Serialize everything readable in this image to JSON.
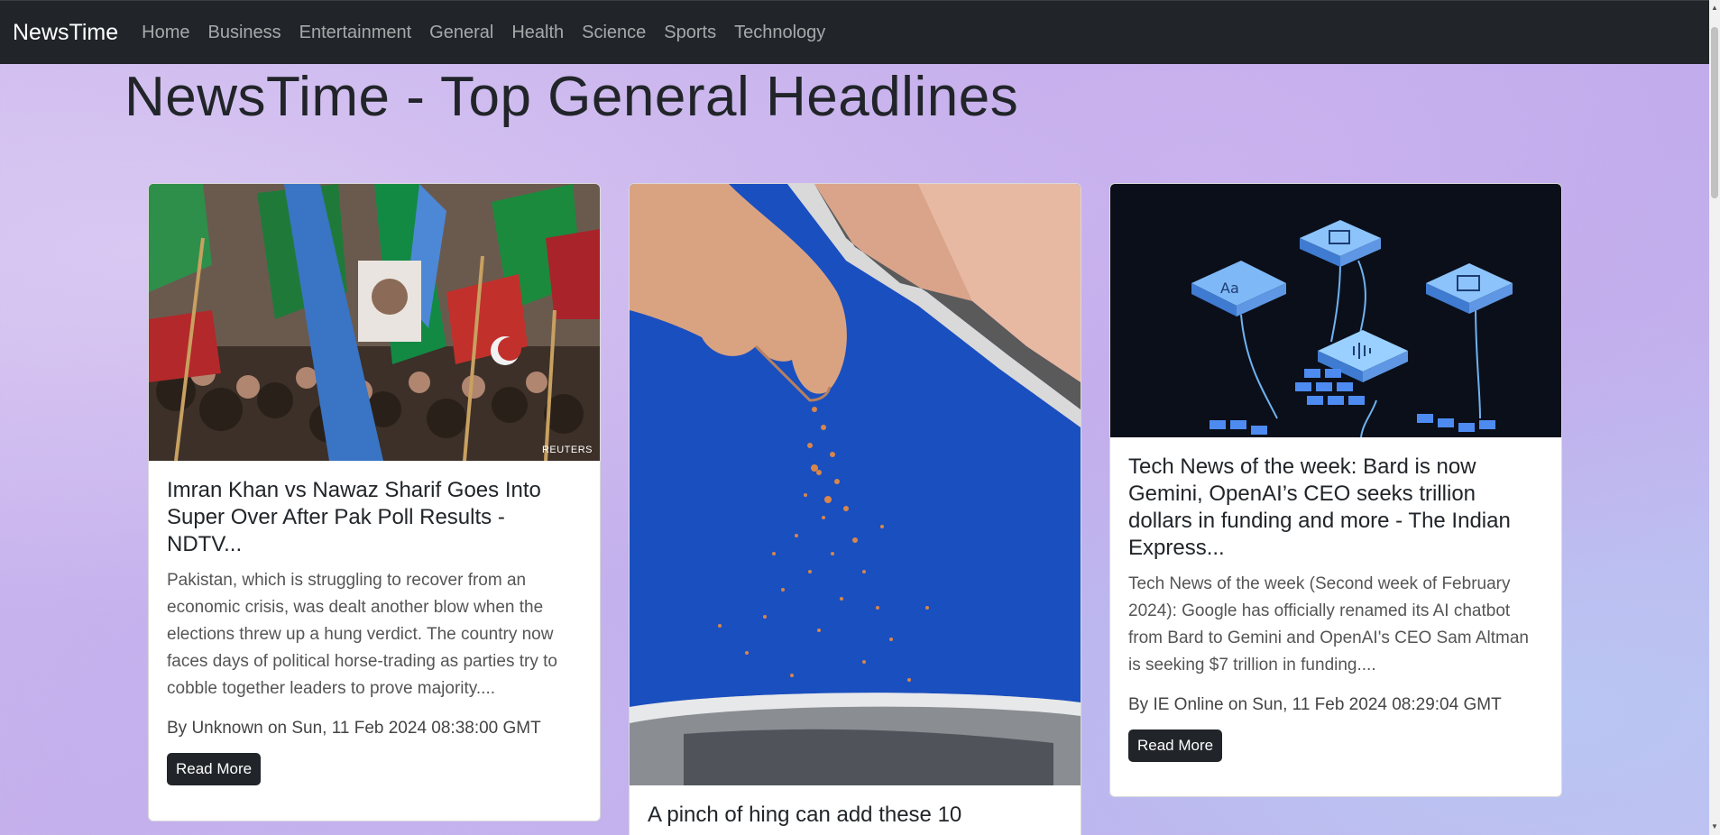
{
  "navbar": {
    "brand": "NewsTime",
    "links": [
      "Home",
      "Business",
      "Entertainment",
      "General",
      "Health",
      "Science",
      "Sports",
      "Technology"
    ]
  },
  "page": {
    "title": "NewsTime - Top General Headlines"
  },
  "cards": [
    {
      "image": "protest-crowd-flags-image",
      "image_credit": "REUTERS",
      "title": "Imran Khan vs Nawaz Sharif Goes Into Super Over After Pak Poll Results - NDTV...",
      "description": "Pakistan, which is struggling to recover from an economic crisis, was dealt another blow when the elections threw up a hung verdict. The country now faces days of political horse-trading as parties try to cobble together leaders to prove majority....",
      "meta": "By Unknown on Sun, 11 Feb 2024 08:38:00 GMT",
      "button": "Read More"
    },
    {
      "image": "sprinkling-spice-image",
      "title": "A pinch of hing can add these 10"
    },
    {
      "image": "ai-tech-tiles-image",
      "title": "Tech News of the week: Bard is now Gemini, OpenAI’s CEO seeks trillion dollars in funding and more - The Indian Express...",
      "description": "Tech News of the week (Second week of February 2024): Google has officially renamed its AI chatbot from Bard to Gemini and OpenAI's CEO Sam Altman is seeking $7 trillion in funding....",
      "meta": "By IE Online on Sun, 11 Feb 2024 08:29:04 GMT",
      "button": "Read More"
    }
  ],
  "colors": {
    "navbar": "#212529",
    "button": "#212529",
    "background": "#c6b3ed"
  }
}
